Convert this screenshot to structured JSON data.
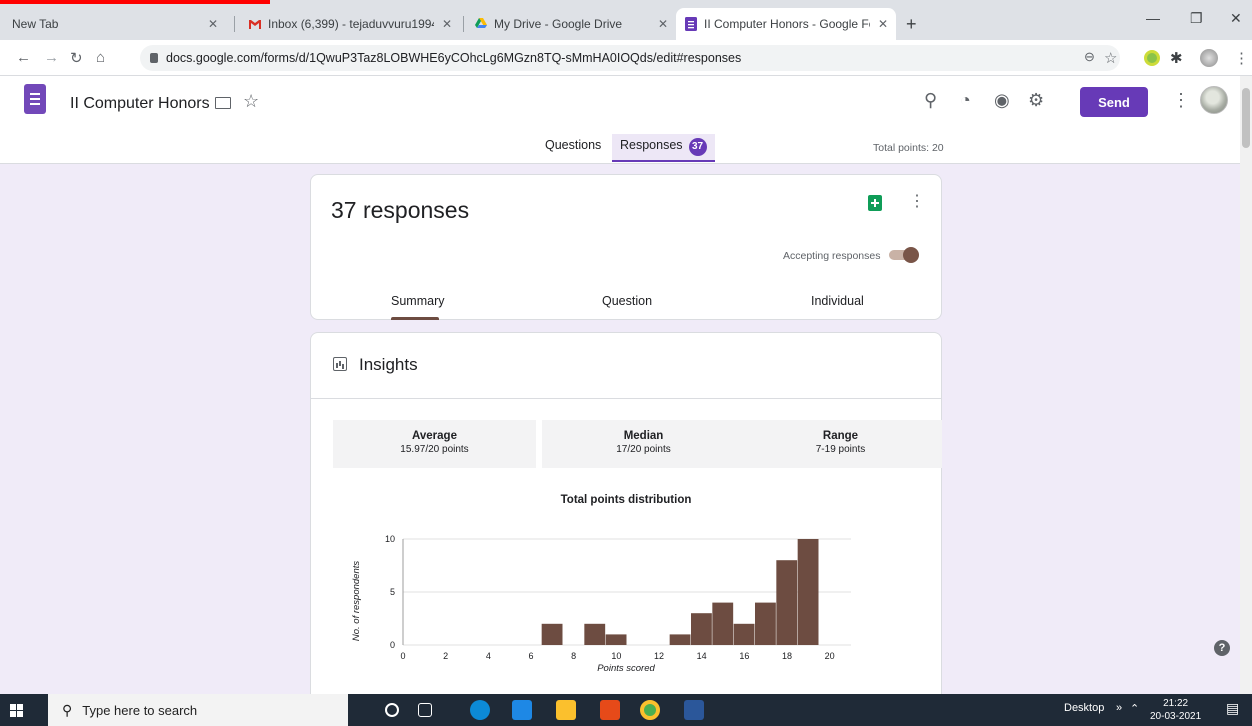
{
  "browser": {
    "tabs": [
      {
        "title": "New Tab"
      },
      {
        "title": "Inbox (6,399) - tejaduvvuru1994("
      },
      {
        "title": "My Drive - Google Drive"
      },
      {
        "title": "II Computer Honors - Google For"
      }
    ],
    "url": "docs.google.com/forms/d/1QwuP3Taz8LOBWHE6yCOhcLg6MGzn8TQ-sMmHA0IOQds/edit#responses"
  },
  "form": {
    "title": "II Computer Honors",
    "send_label": "Send",
    "tab_questions": "Questions",
    "tab_responses": "Responses",
    "responses_count": "37",
    "total_points": "Total points: 20"
  },
  "responses_card": {
    "heading": "37 responses",
    "accepting_label": "Accepting responses",
    "accepting": true,
    "tabs": [
      "Summary",
      "Question",
      "Individual"
    ]
  },
  "insights": {
    "title": "Insights",
    "stats": [
      {
        "label": "Average",
        "value": "15.97/20 points"
      },
      {
        "label": "Median",
        "value": "17/20 points"
      },
      {
        "label": "Range",
        "value": "7-19 points"
      }
    ]
  },
  "chart_data": {
    "type": "bar",
    "title": "Total points distribution",
    "xlabel": "Points scored",
    "ylabel": "No. of respondents",
    "xlim": [
      0,
      21
    ],
    "ylim": [
      0,
      10
    ],
    "xticks": [
      0,
      2,
      4,
      6,
      8,
      10,
      12,
      14,
      16,
      18,
      20
    ],
    "yticks": [
      0,
      5,
      10
    ],
    "grid": true,
    "color": "#6d4c41",
    "x": [
      7,
      9,
      10,
      13,
      14,
      15,
      16,
      17,
      18,
      19
    ],
    "values": [
      2,
      2,
      1,
      1,
      3,
      4,
      2,
      4,
      8,
      10
    ]
  },
  "taskbar": {
    "search_placeholder": "Type here to search",
    "desktop_label": "Desktop",
    "time": "21:22",
    "date": "20-03-2021"
  }
}
